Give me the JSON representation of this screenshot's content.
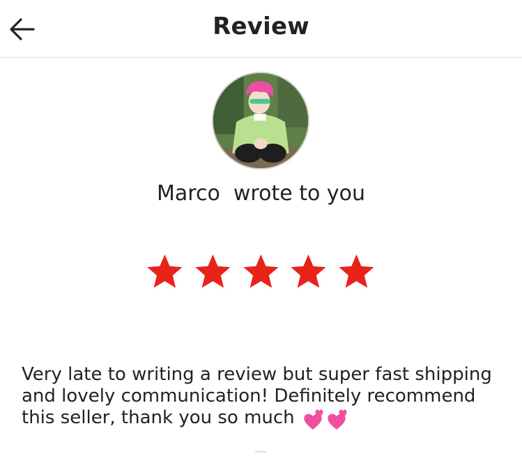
{
  "header": {
    "title": "Review",
    "back_icon": "arrow-left-icon"
  },
  "reviewer": {
    "name_line": "Marco  wrote to you",
    "avatar_icon": "user-avatar"
  },
  "rating": {
    "value": 5,
    "max": 5,
    "star_color": "#e8231b",
    "star_icon": "star-icon"
  },
  "review": {
    "text": "Very late to writing a review but super fast shipping and lovely communication! Definitely recommend this seller, thank you so much ",
    "emoji_icon": "two-hearts-emoji"
  }
}
